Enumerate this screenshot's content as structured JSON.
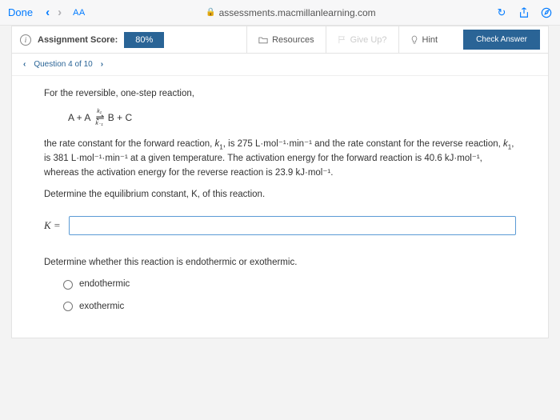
{
  "browser": {
    "done": "Done",
    "aa": "AA",
    "url": "assessments.macmillanlearning.com"
  },
  "toolbar": {
    "score_label": "Assignment Score:",
    "score_value": "80%",
    "resources": "Resources",
    "giveup": "Give Up?",
    "hint": "Hint",
    "check": "Check Answer"
  },
  "qnav": {
    "label": "Question 4 of 10"
  },
  "question": {
    "intro": "For the reversible, one-step reaction,",
    "eq_left": "A + A",
    "eq_right": "B + C",
    "k_top": "k₁",
    "k_bot": "k₋₁",
    "body_a": "the rate constant for the forward reaction, ",
    "body_b": ", is 275 L·mol⁻¹·min⁻¹ and the rate constant for the reverse reaction, ",
    "body_c": ", is 381 L·mol⁻¹·min⁻¹ at a given temperature. The activation energy for the forward reaction is 40.6 kJ·mol⁻¹, whereas the activation energy for the reverse reaction is 23.9 kJ·mol⁻¹.",
    "prompt1": "Determine the equilibrium constant, K, of this reaction.",
    "kvar": "K =",
    "prompt2": "Determine whether this reaction is endothermic or exothermic.",
    "opt1": "endothermic",
    "opt2": "exothermic"
  }
}
